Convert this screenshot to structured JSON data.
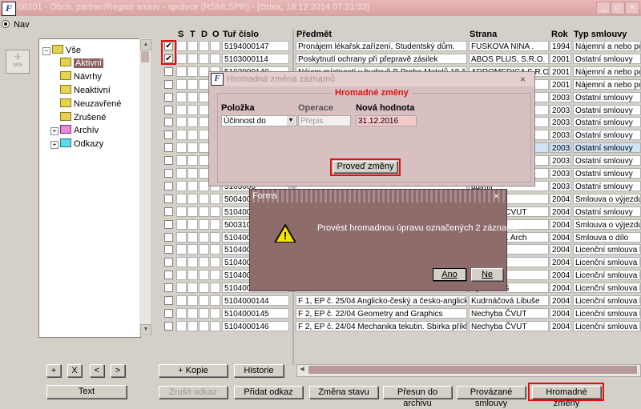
{
  "window": {
    "title": "08201 - Obch. partner/Registr smluv - správce (RSMLSPR) - [čtrtex, 18.12.2014 07:21:33]",
    "app_icon": "forms-logo-icon",
    "logo_text": "F",
    "ctl_min": "_",
    "ctl_max": "□",
    "ctl_close": "×"
  },
  "nav": {
    "label": "Nav",
    "sps_label": "SPS"
  },
  "tree": {
    "root": "Vše",
    "expand_minus": "−",
    "expand_plus": "+",
    "items": [
      {
        "label": "Aktivní"
      },
      {
        "label": "Návrhy"
      },
      {
        "label": "Neaktivní"
      },
      {
        "label": "Neuzavřené"
      },
      {
        "label": "Zrušené"
      }
    ],
    "archiv": "Archív",
    "odkazy": "Odkazy"
  },
  "tree_buttons": {
    "plus": "+",
    "x": "X",
    "lt": "<",
    "gt": ">",
    "text": "Text"
  },
  "grid": {
    "headers": {
      "s": "S",
      "t": "T",
      "d": "D",
      "o": "O",
      "cislo": "Tuř číslo",
      "predmet": "Předmět",
      "strana": "Strana",
      "rok": "Rok",
      "typ": "Typ smlouvy"
    },
    "rows": [
      {
        "check": "✔",
        "excl": "!",
        "cislo": "5194000147",
        "predmet": "Pronájem lékařsk.zařízení, Studentský dům.",
        "strana": "FUSKOVA NINA .",
        "rok": "1994",
        "typ": "Nájemní a nebo podn"
      },
      {
        "check": "✔",
        "excl": "",
        "cislo": "5103000114",
        "predmet": "Poskytnutí ochrany při přepravě zásilek",
        "strana": "ABOS PLUS, S.R.O.",
        "rok": "2001",
        "typ": "Ostatní smlouvy"
      },
      {
        "check": "",
        "excl": "!",
        "cislo": "5103000140",
        "predmet": "Nájem místností v budově B Praha Motolů 18 č.23 č.23",
        "strana": "ADROMEDICA S.R.O.",
        "rok": "2001",
        "typ": "Nájemní a nebo podn"
      },
      {
        "check": "",
        "excl": "!",
        "cislo": "",
        "predmet": "",
        "strana": "",
        "rok": "2001",
        "typ": "Nájemní a nebo podn"
      },
      {
        "check": "",
        "excl": "",
        "cislo": "",
        "predmet": "",
        "strana": "",
        "rok": "2003",
        "typ": "Ostatní smlouvy"
      },
      {
        "check": "",
        "excl": "",
        "cislo": "",
        "predmet": "",
        "strana": "",
        "rok": "2003",
        "typ": "Ostatní smlouvy"
      },
      {
        "check": "",
        "excl": "",
        "cislo": "",
        "predmet": "",
        "strana": "",
        "rok": "2003",
        "typ": "Ostatní smlouvy"
      },
      {
        "check": "",
        "excl": "",
        "cislo": "",
        "predmet": "",
        "strana": "",
        "rok": "2003",
        "typ": "Ostatní smlouvy"
      },
      {
        "check": "",
        "excl": "",
        "cislo": "",
        "predmet": "",
        "strana": "",
        "rok": "2003",
        "typ": "Ostatní smlouvy"
      },
      {
        "check": "",
        "excl": "",
        "cislo": "",
        "predmet": "",
        "strana": "",
        "rok": "2003",
        "typ": "Ostatní smlouvy"
      },
      {
        "check": "",
        "excl": "",
        "cislo": "",
        "predmet": "",
        "strana": "",
        "rok": "2003",
        "typ": "Ostatní smlouvy"
      },
      {
        "check": "",
        "excl": "",
        "cislo": "5103000",
        "predmet": "",
        "strana": "adimír",
        "rok": "2003",
        "typ": "Ostatní smlouvy"
      },
      {
        "check": "",
        "excl": "",
        "cislo": "5004000",
        "predmet": "",
        "strana": "",
        "rok": "2004",
        "typ": "Smlouva o výjezdu s"
      },
      {
        "check": "",
        "excl": "",
        "cislo": "5104000",
        "predmet": "",
        "strana": "KA UNIE.CVUT",
        "rok": "2004",
        "typ": "Ostatní smlouvy"
      },
      {
        "check": "",
        "excl": "",
        "cislo": "5003100",
        "predmet": "",
        "strana": "ěpán",
        "rok": "2004",
        "typ": "Smlouva o výjezdu s"
      },
      {
        "check": "",
        "excl": "",
        "cislo": "5104000",
        "predmet": "",
        "strana": "NS S.R.O. Arch",
        "rok": "2004",
        "typ": "Smlouva o dílo"
      },
      {
        "check": "",
        "excl": "",
        "cislo": "5104000",
        "predmet": "",
        "strana": "rtin",
        "rok": "2004",
        "typ": "Licenční smlouva k p"
      },
      {
        "check": "",
        "excl": "",
        "cislo": "5104000",
        "predmet": "",
        "strana": "Aleš",
        "rok": "2004",
        "typ": "Licenční smlouva k p"
      },
      {
        "check": "",
        "excl": "",
        "cislo": "5104000",
        "predmet": "",
        "strana": "na",
        "rok": "2004",
        "typ": "Licenční smlouva k p"
      },
      {
        "check": "",
        "excl": "",
        "cislo": "5104000143",
        "predmet": "F 1,  EP č. 24/04  Deutsch im Bauwesen",
        "strana": "Vydra Aleš",
        "rok": "2004",
        "typ": "Licenční smlouva k p"
      },
      {
        "check": "",
        "excl": "",
        "cislo": "5104000144",
        "predmet": "F 1,  EP č. 25/04  Anglicko-český a česko-anglický slov",
        "strana": "Kudrnáčová Libuše",
        "rok": "2004",
        "typ": "Licenční smlouva k p"
      },
      {
        "check": "",
        "excl": "",
        "cislo": "5104000145",
        "predmet": "F 2, EP č. 22/04   Geometry and Graphics",
        "strana": "Nechyba ČVUT",
        "rok": "2004",
        "typ": "Licenční smlouva k p"
      },
      {
        "check": "",
        "excl": "",
        "cislo": "5104000146",
        "predmet": "F 2, EP č. 24/04  Mechanika tekutin. Sbírka příkladů",
        "strana": "Nechyba ČVUT",
        "rok": "2004",
        "typ": "Licenční smlouva k p"
      }
    ]
  },
  "mid_buttons": {
    "kopie": "+ Kopie",
    "historie": "Historie"
  },
  "bottom_buttons": {
    "zrusit": "Zrušit odkaz",
    "pridat": "Přidat odkaz",
    "zmena": "Změna stavu",
    "presun": "Přesun do archivu",
    "provazane": "Provázané smlouvy",
    "hromadne": "Hromadné změny"
  },
  "dialog_bulk": {
    "title": "Hromadná změna záznamů",
    "group_title": "Hromadné změny",
    "col_polozka": "Položka",
    "col_operace": "Operace",
    "col_hodnota": "Nová hodnota",
    "polozka_value": "Účinnost do",
    "operace_value": "Přepis",
    "hodnota_value": "31.12.2016",
    "execute": "Proveď změny",
    "close": "×"
  },
  "dialog_forms": {
    "title": "Forms",
    "message": "Provést hromadnou úpravu označených 2 záznamů?",
    "yes": "Ano",
    "no": "Ne",
    "close": "×",
    "warn_mark": "!"
  },
  "colors": {
    "accent_red": "#e01010",
    "title_pink": "#d9a0a0",
    "dialog_brown": "#8f6c6c"
  }
}
